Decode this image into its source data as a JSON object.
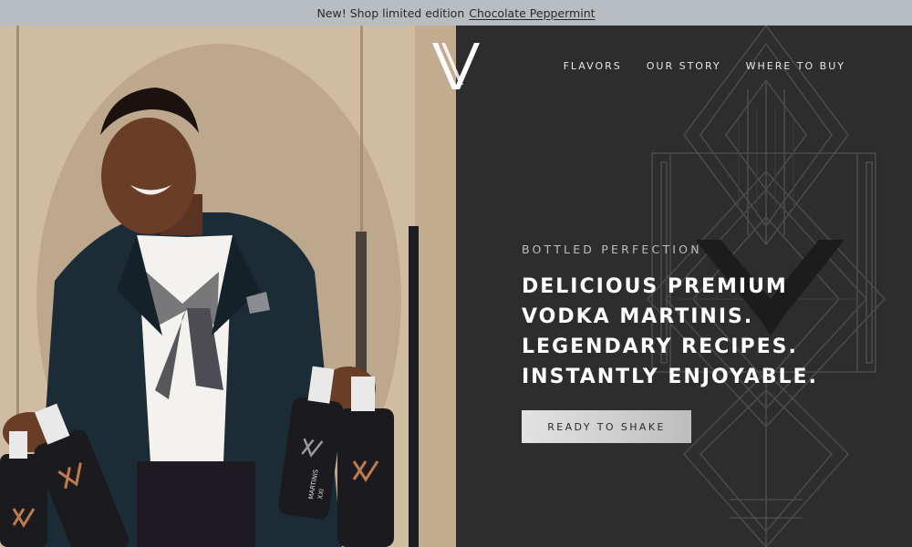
{
  "announcement": {
    "text": "New! Shop limited edition",
    "link": "Chocolate Peppermint"
  },
  "nav": {
    "items": [
      "FLAVORS",
      "OUR STORY",
      "WHERE TO BUY"
    ]
  },
  "hero": {
    "eyebrow": "BOTTLED PERFECTION",
    "headline": [
      "DELICIOUS PREMIUM",
      "VODKA MARTINIS.",
      "LEGENDARY RECIPES.",
      "INSTANTLY ENJOYABLE."
    ],
    "cta_label": "READY TO SHAKE"
  },
  "bottle_label": {
    "line1": "XXI",
    "line2": "MARTINIS"
  },
  "colors": {
    "announcement_bg": "#b7bdc1",
    "hero_bg": "#2d2d2d",
    "accent_copper": "#c07a4f",
    "text_light": "#ffffff"
  },
  "icons": {
    "logo": "x-monogram-logo"
  }
}
